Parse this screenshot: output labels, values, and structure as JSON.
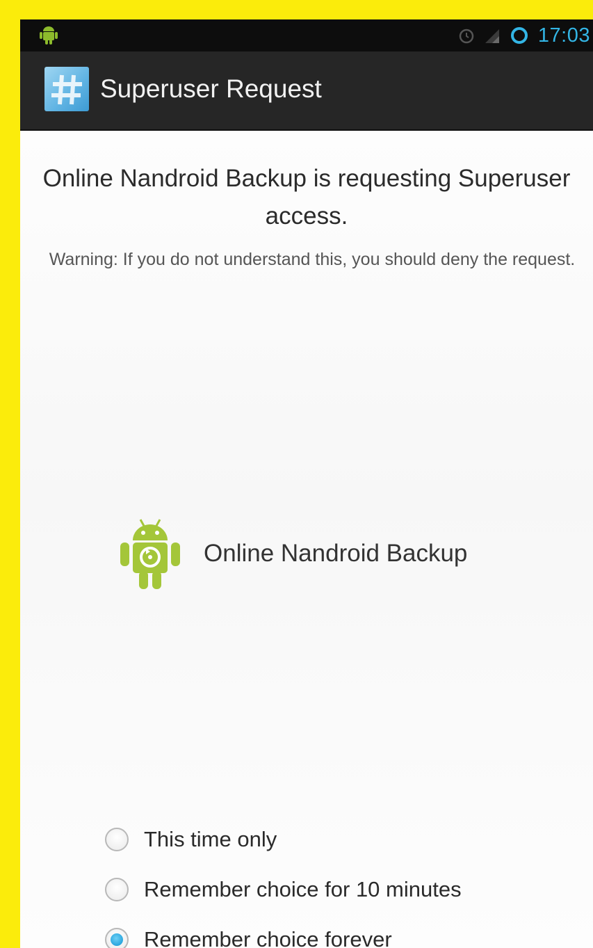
{
  "status_bar": {
    "time": "17:03",
    "icons": [
      "android-notification-icon",
      "alarm-icon",
      "signal-icon",
      "sync-icon"
    ]
  },
  "action_bar": {
    "icon": "superuser-hash-icon",
    "title": "Superuser Request"
  },
  "request": {
    "heading": "Online Nandroid Backup is requesting Superuser access.",
    "warning": "Warning: If you do not understand this, you should deny the request."
  },
  "app": {
    "icon": "android-app-icon",
    "name": "Online Nandroid Backup",
    "icon_color": "#a4c639"
  },
  "remember_options": {
    "selected": "Remember choice forever",
    "items": [
      {
        "label": "This time only",
        "checked": false
      },
      {
        "label": "Remember choice for 10 minutes",
        "checked": false
      },
      {
        "label": "Remember choice forever",
        "checked": true
      }
    ]
  },
  "colors": {
    "accent": "#33b5e5",
    "frame": "#fbec0b",
    "action_bar": "#262626"
  }
}
